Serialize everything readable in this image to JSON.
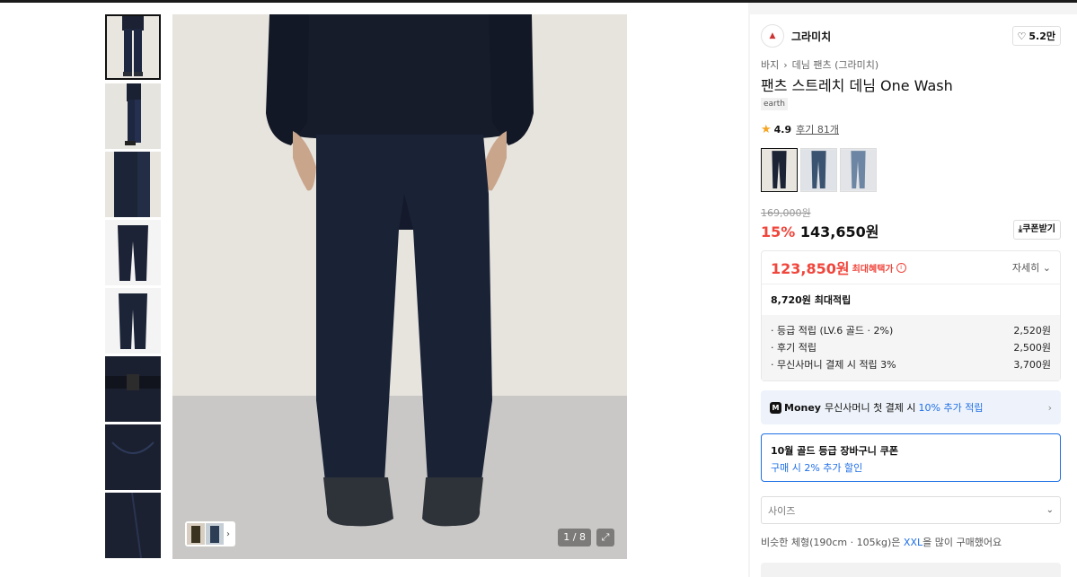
{
  "gallery": {
    "thumbnails": [
      {
        "alt": "front-full"
      },
      {
        "alt": "side-full"
      },
      {
        "alt": "detail-leg"
      },
      {
        "alt": "flat-front"
      },
      {
        "alt": "flat-back"
      },
      {
        "alt": "waist-detail"
      },
      {
        "alt": "pocket-detail"
      },
      {
        "alt": "hem-detail"
      }
    ],
    "counter": "1 / 8",
    "expand_icon": "expand-icon"
  },
  "brand": {
    "name": "그라미치",
    "like_count": "5.2만",
    "like_icon": "heart-icon"
  },
  "breadcrumb": [
    "바지",
    "데님 팬츠 (그라미치)"
  ],
  "product": {
    "title": "팬츠 스트레치 데님 One Wash",
    "tag": "earth",
    "rating": "4.9",
    "reviews": "후기 81개",
    "colors": [
      "#1b2335",
      "#3a5370",
      "#6d86a4"
    ]
  },
  "price": {
    "original": "169,000원",
    "discount": "15%",
    "sale": "143,650원",
    "coupon_button": "쿠폰받기"
  },
  "benefits": {
    "best_price": "123,850원",
    "best_label": "최대혜택가",
    "detail_link": "자세히",
    "max_points": "8,720원 최대적립",
    "items": [
      {
        "label": "· 등급 적립 (LV.6 골드 · 2%)",
        "value": "2,520원"
      },
      {
        "label": "· 후기 적립",
        "value": "2,500원"
      },
      {
        "label": "· 무신사머니 결제 시 적립 3%",
        "value": "3,700원"
      }
    ]
  },
  "money": {
    "logo": "M",
    "brand": "Money",
    "text": "무신사머니 첫 결제 시",
    "highlight": "10% 추가 적립"
  },
  "coupon": {
    "title": "10월 골드 등급 장바구니 쿠폰",
    "subtitle": "구매 시 2% 추가 할인"
  },
  "size": {
    "placeholder": "사이즈",
    "note_prefix": "비슷한 체형(190cm · 105kg)은 ",
    "note_highlight": "XXL",
    "note_suffix": "을 많이 구매했어요"
  },
  "colors": {
    "accent_red": "#f0463c",
    "accent_blue": "#1f6fe6"
  }
}
